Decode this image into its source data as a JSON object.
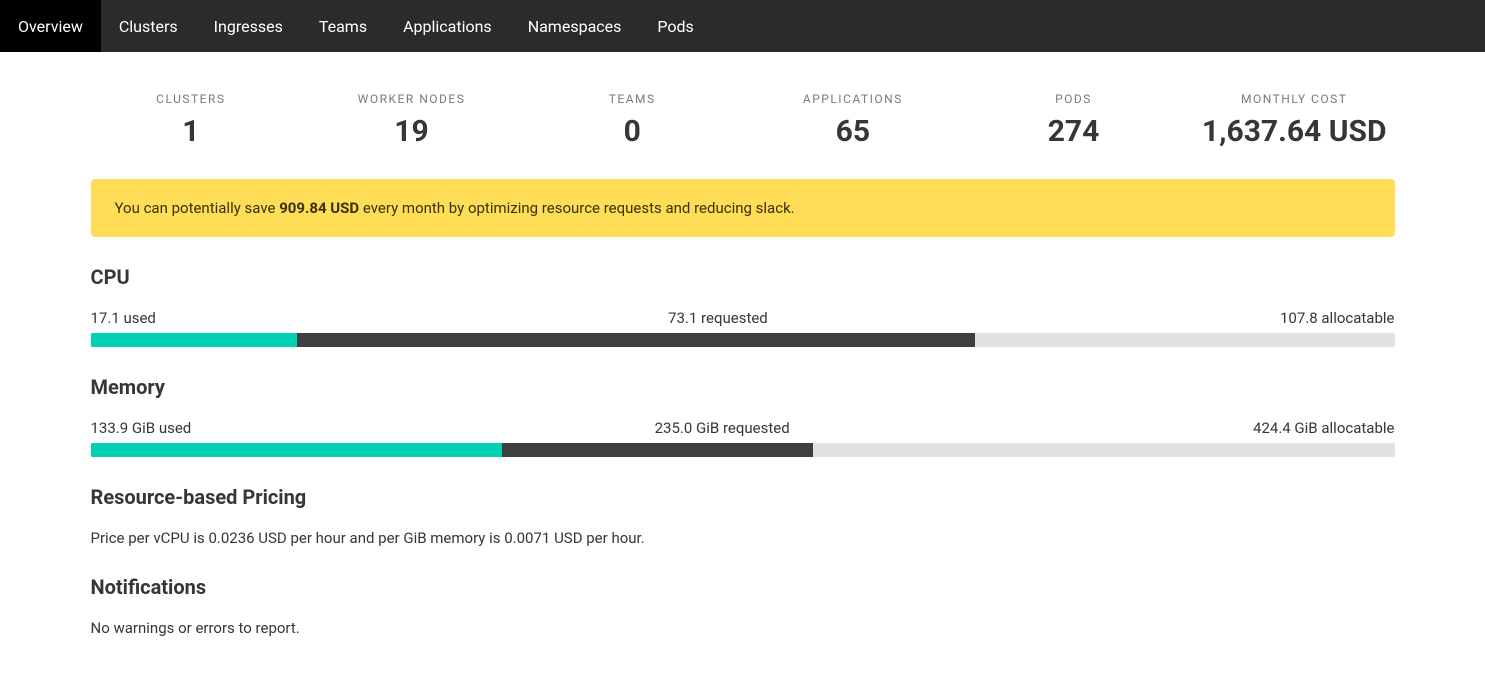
{
  "nav": {
    "items": [
      {
        "label": "Overview",
        "active": true
      },
      {
        "label": "Clusters",
        "active": false
      },
      {
        "label": "Ingresses",
        "active": false
      },
      {
        "label": "Teams",
        "active": false
      },
      {
        "label": "Applications",
        "active": false
      },
      {
        "label": "Namespaces",
        "active": false
      },
      {
        "label": "Pods",
        "active": false
      }
    ]
  },
  "stats": {
    "clusters": {
      "label": "CLUSTERS",
      "value": "1"
    },
    "worker_nodes": {
      "label": "WORKER NODES",
      "value": "19"
    },
    "teams": {
      "label": "TEAMS",
      "value": "0"
    },
    "applications": {
      "label": "APPLICATIONS",
      "value": "65"
    },
    "pods": {
      "label": "PODS",
      "value": "274"
    },
    "monthly_cost": {
      "label": "MONTHLY COST",
      "value": "1,637.64 USD"
    }
  },
  "banner": {
    "prefix": "You can potentially save ",
    "amount": "909.84 USD",
    "suffix": " every month by optimizing resource requests and reducing slack."
  },
  "cpu": {
    "title": "CPU",
    "used_label": "17.1 used",
    "requested_label": "73.1 requested",
    "allocatable_label": "107.8 allocatable",
    "used_pct": 15.86,
    "requested_pct": 67.81
  },
  "memory": {
    "title": "Memory",
    "used_label": "133.9 GiB used",
    "requested_label": "235.0 GiB requested",
    "allocatable_label": "424.4 GiB allocatable",
    "used_pct": 31.55,
    "requested_pct": 55.37
  },
  "pricing": {
    "title": "Resource-based Pricing",
    "text": "Price per vCPU is 0.0236 USD per hour and per GiB memory is 0.0071 USD per hour."
  },
  "notifications": {
    "title": "Notifications",
    "text": "No warnings or errors to report."
  }
}
